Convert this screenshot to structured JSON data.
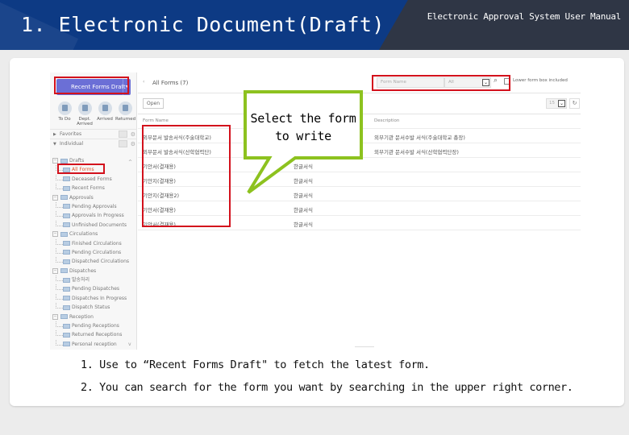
{
  "header": {
    "page_title": "1. Electronic Document(Draft)",
    "manual_title": "Electronic Approval System User Manual"
  },
  "sidebar": {
    "recent_forms_button": "Recent Forms Draft",
    "quick_actions": [
      {
        "label": "To Do",
        "icon": "todo-icon"
      },
      {
        "label": "Dept. Arrived",
        "icon": "dept-icon"
      },
      {
        "label": "Arrived",
        "icon": "arrived-icon"
      },
      {
        "label": "Returned",
        "icon": "returned-icon"
      }
    ],
    "sections": [
      {
        "label": "Favorites",
        "state": "collapsed"
      },
      {
        "label": "Individual",
        "state": "expanded"
      }
    ],
    "tree": [
      {
        "label": "Drafts",
        "level": 0
      },
      {
        "label": "All Forms",
        "level": 1,
        "selected": true
      },
      {
        "label": "Deceased Forms",
        "level": 1
      },
      {
        "label": "Recent Forms",
        "level": 1
      },
      {
        "label": "Approvals",
        "level": 0
      },
      {
        "label": "Pending Approvals",
        "level": 1
      },
      {
        "label": "Approvals In Progress",
        "level": 1
      },
      {
        "label": "Unfinished Documents",
        "level": 1
      },
      {
        "label": "Circulations",
        "level": 0
      },
      {
        "label": "Finished Circulations",
        "level": 1
      },
      {
        "label": "Pending Circulations",
        "level": 1
      },
      {
        "label": "Dispatched Circulations",
        "level": 1
      },
      {
        "label": "Dispatches",
        "level": 0
      },
      {
        "label": "발송처리",
        "level": 1
      },
      {
        "label": "Pending Dispatches",
        "level": 1
      },
      {
        "label": "Dispatches In Progress",
        "level": 1
      },
      {
        "label": "Dispatch Status",
        "level": 1
      },
      {
        "label": "Reception",
        "level": 0
      },
      {
        "label": "Pending Receptions",
        "level": 1
      },
      {
        "label": "Returned Receptions",
        "level": 1
      },
      {
        "label": "Personal reception",
        "level": 1
      }
    ]
  },
  "main": {
    "title": "All Forms (7)",
    "search_placeholder": "Form Name",
    "search_scope": "All",
    "lower_form_label": "Lower form box included",
    "open_button": "Open",
    "page_size": "15",
    "columns": [
      "Form Name",
      "Description"
    ],
    "rows": [
      {
        "name": "외부문서 발송서식(주술대학교)",
        "description": "외부기관 문서수발 서식(주술대학교 총장)"
      },
      {
        "name": "외부문서 발송서식(산학협력단)",
        "description": "외부기관 문서수발 서식(산학협력단장)"
      },
      {
        "name": "기안서(결재용)",
        "description": "한글서식"
      },
      {
        "name": "기안지(결재용)",
        "description": "한글서식"
      },
      {
        "name": "기안지(결재용2)",
        "description": "한글서식"
      },
      {
        "name": "기안서(결재용)",
        "description": "한글서식"
      },
      {
        "name": "기안서(결재용)",
        "description": "한글서식"
      }
    ]
  },
  "callout": {
    "text_line1": "Select the form",
    "text_line2": "to write",
    "border_color": "#8dc21f"
  },
  "notes": [
    "1. Use to  “Recent Forms Draft\" to fetch the latest form.",
    "2. You can search for the form you want by searching in the upper right corner."
  ],
  "colors": {
    "highlight_red": "#d3111c",
    "header_bg": "#2f3645",
    "header_blue": "#0d3a84",
    "button_purple": "#6b6fd6"
  }
}
